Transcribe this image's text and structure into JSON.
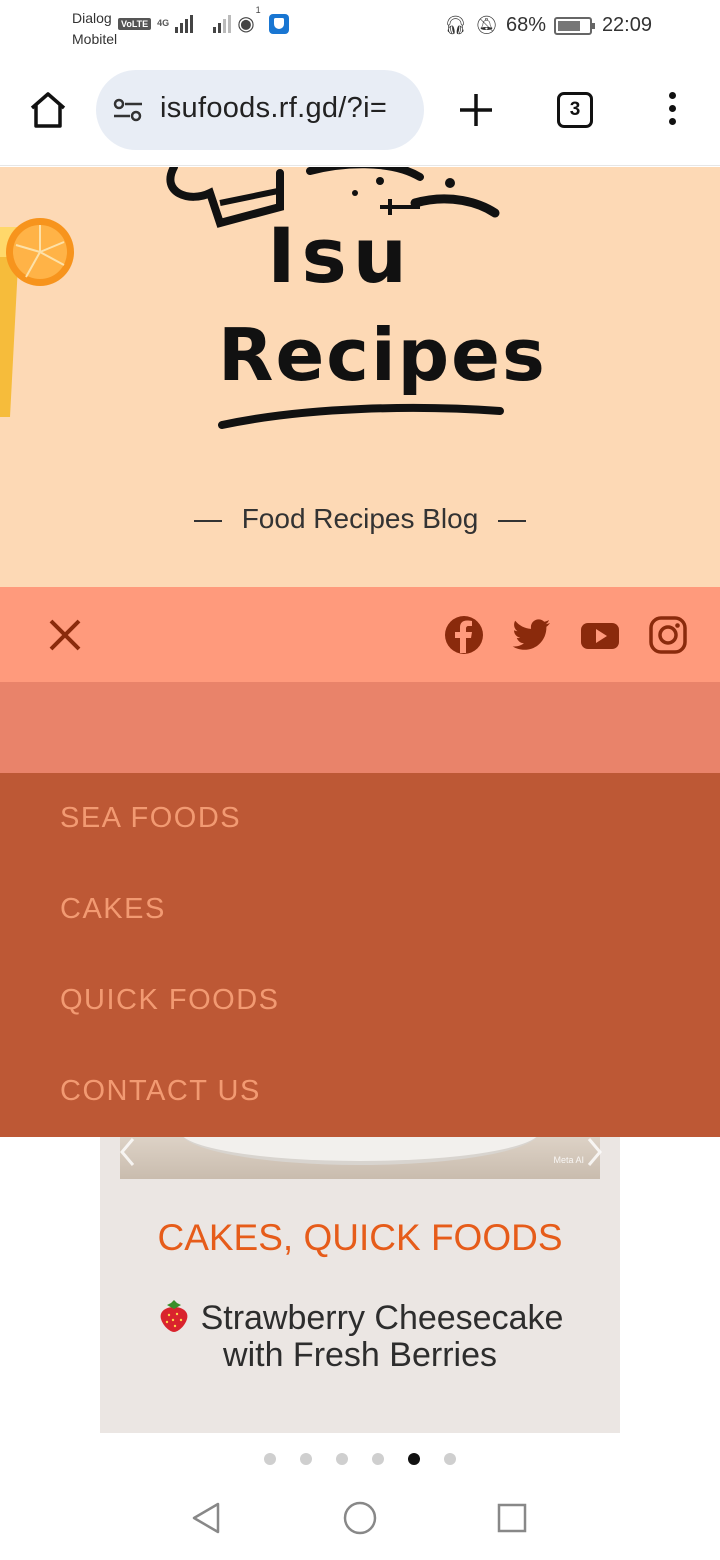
{
  "status_bar": {
    "carrier_1": "Dialog",
    "carrier_2": "Mobitel",
    "volte": "VoLTE",
    "network": "4G",
    "hotspot_count": "1",
    "battery": "68%",
    "time": "22:09",
    "icons": [
      "signal-icon",
      "hotspot-icon",
      "vpn-shield-icon",
      "headphones-icon",
      "bell-muted-icon",
      "battery-icon"
    ]
  },
  "browser": {
    "url": "isufoods.rf.gd/?i=",
    "tab_count": "3",
    "icons": [
      "home-icon",
      "site-settings-icon",
      "new-tab-plus-icon",
      "tabs-icon",
      "more-menu-icon"
    ]
  },
  "header": {
    "logo_line_1": "Isu",
    "logo_line_2": "Recipes",
    "tagline": "Food Recipes Blog"
  },
  "social": {
    "icons": [
      "close-icon",
      "facebook-icon",
      "twitter-icon",
      "youtube-icon",
      "instagram-icon"
    ],
    "accent": "#8a2a0c"
  },
  "menu": {
    "items": [
      "SEA FOODS",
      "CAKES",
      "QUICK FOODS",
      "CONTACT US"
    ],
    "bg_color": "#bd5835",
    "text_color": "#f29a72"
  },
  "carousel": {
    "image_watermark": "Meta AI",
    "categories": "CAKES, QUICK FOODS",
    "title_emoji": "strawberry",
    "title_line_1": "Strawberry Cheesecake",
    "title_line_2": "with Fresh Berries",
    "slide_count": 6,
    "active_slide": 5
  },
  "colors": {
    "header_bg": "#fdd9b5",
    "social_bar_bg": "#ff9a7c",
    "band_bg": "#e9836a",
    "category_text": "#e65c1a"
  }
}
